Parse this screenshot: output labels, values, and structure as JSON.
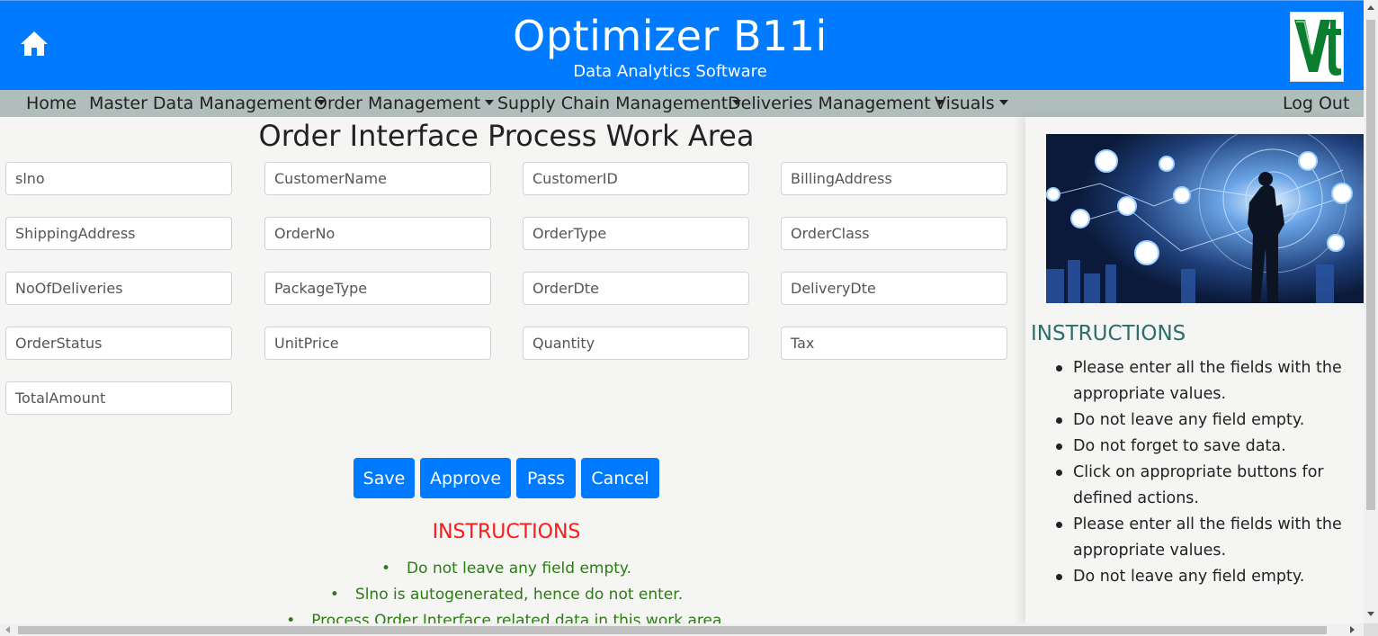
{
  "header": {
    "title": "Optimizer B11i",
    "subtitle": "Data Analytics Software",
    "home_icon": "home-icon",
    "logo_icon": "vt-logo"
  },
  "nav": {
    "home": "Home",
    "master_data": "Master Data Management",
    "order_mgmt": "Order Management",
    "supply_chain": "Supply Chain Management",
    "deliveries": "Deliveries Management",
    "visuals": "Visuals",
    "logout": "Log Out"
  },
  "page_title": "Order Interface Process Work Area",
  "fields": {
    "slno": "slno",
    "customer_name": "CustomerName",
    "customer_id": "CustomerID",
    "billing_address": "BillingAddress",
    "shipping_address": "ShippingAddress",
    "order_no": "OrderNo",
    "order_type": "OrderType",
    "order_class": "OrderClass",
    "no_of_deliveries": "NoOfDeliveries",
    "package_type": "PackageType",
    "order_dte": "OrderDte",
    "delivery_dte": "DeliveryDte",
    "order_status": "OrderStatus",
    "unit_price": "UnitPrice",
    "quantity": "Quantity",
    "tax": "Tax",
    "total_amount": "TotalAmount"
  },
  "buttons": {
    "save": "Save",
    "approve": "Approve",
    "pass": "Pass",
    "cancel": "Cancel"
  },
  "main_instructions": {
    "title": "INSTRUCTIONS",
    "items": [
      "Do not leave any field empty.",
      "Slno is autogenerated, hence do not enter.",
      "Process Order Interface related data in this work area."
    ]
  },
  "side_instructions": {
    "title": "INSTRUCTIONS",
    "items": [
      "Please enter all the fields with the appropriate values.",
      "Do not leave any field empty.",
      "Do not forget to save data.",
      "Click on appropriate buttons for defined actions.",
      "Please enter all the fields with the appropriate values.",
      "Do not leave any field empty."
    ]
  },
  "colors": {
    "header_bg": "#007bff",
    "nav_bg": "#b0bdbb",
    "instructions_red": "#ff1a1a",
    "instructions_green": "#2a7d12",
    "side_title": "#2b6e6e"
  }
}
